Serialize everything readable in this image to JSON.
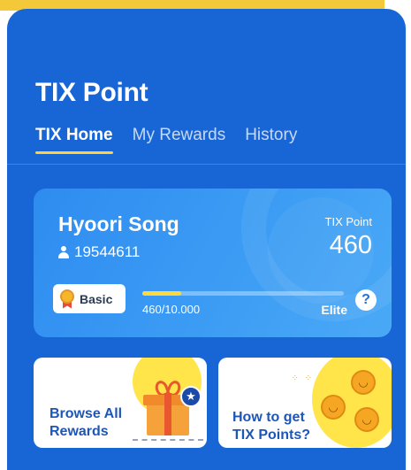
{
  "header": {
    "title": "TIX Point"
  },
  "tabs": [
    {
      "label": "TIX Home",
      "active": true
    },
    {
      "label": "My Rewards",
      "active": false
    },
    {
      "label": "History",
      "active": false
    }
  ],
  "member_card": {
    "name": "Hyoori Song",
    "member_id": "19544611",
    "point_label": "TIX Point",
    "point_value": "460",
    "tier": "Basic",
    "progress_text": "460/10.000",
    "progress_fraction": 0.046,
    "next_tier": "Elite",
    "help_symbol": "?"
  },
  "promos": [
    {
      "line1": "Browse All",
      "line2": "Rewards",
      "icon": "gift-icon"
    },
    {
      "line1": "How to get",
      "line2": "TIX Points?",
      "icon": "coins-icon"
    }
  ],
  "colors": {
    "app_background": "#1866d6",
    "card_gradient_start": "#2e8cf0",
    "tab_underline": "#ffd23c",
    "promo_text": "#1d56b9",
    "progress_fill": "#ffd83b"
  }
}
